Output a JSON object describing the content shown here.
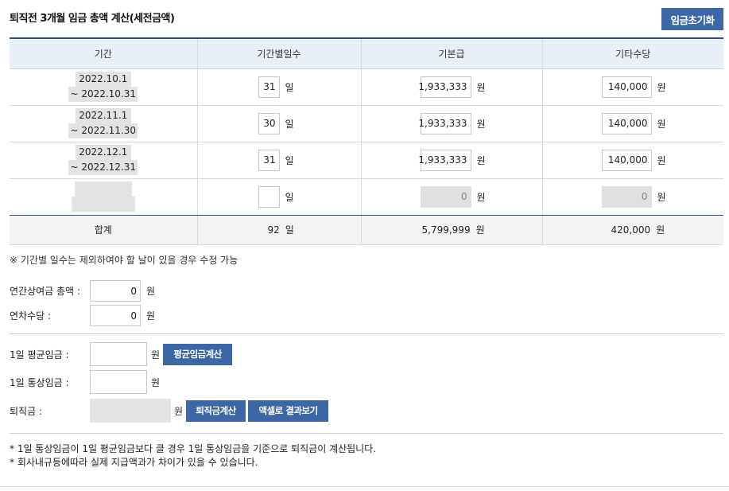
{
  "title": "퇴직전 3개월 임금 총액 계산(세전금액)",
  "reset_button": "임금초기화",
  "table": {
    "headers": [
      "기간",
      "기간별일수",
      "기본급",
      "기타수당"
    ],
    "day_unit": "일",
    "won_unit": "원",
    "rows": [
      {
        "period_start": "2022.10.1",
        "period_end": "~ 2022.10.31",
        "days": "31",
        "base": "1,933,333",
        "other": "140,000"
      },
      {
        "period_start": "2022.11.1",
        "period_end": "~ 2022.11.30",
        "days": "30",
        "base": "1,933,333",
        "other": "140,000"
      },
      {
        "period_start": "2022.12.1",
        "period_end": "~ 2022.12.31",
        "days": "31",
        "base": "1,933,333",
        "other": "140,000"
      },
      {
        "period_start": "",
        "period_end": "",
        "days": "",
        "base": "0",
        "other": "0"
      }
    ],
    "total": {
      "label": "합계",
      "days": "92",
      "base": "5,799,999",
      "other": "420,000"
    }
  },
  "note": "※ 기간별 일수는 제외하여야 할 날이 있을 경우 수정 가능",
  "bonus": {
    "label": "연간상여금 총액 :",
    "value": "0",
    "unit": "원"
  },
  "annual_leave": {
    "label": "연차수당 :",
    "value": "0",
    "unit": "원"
  },
  "avg_wage": {
    "label": "1일 평균임금 :",
    "value": "",
    "unit": "원",
    "button": "평균임금계산"
  },
  "ordinary_wage": {
    "label": "1일 통상임금 :",
    "value": "",
    "unit": "원"
  },
  "severance": {
    "label": "퇴직금 :",
    "value": "",
    "unit": "원",
    "calc_button": "퇴직금계산",
    "excel_button": "액셀로 결과보기"
  },
  "footnotes": [
    "* 1일 통상임금이 1일 평균임금보다 클 경우 1일 통상임금을 기준으로 퇴직금이 계산됩니다.",
    "* 회사내규등에따라 실제 지급액과가 차이가 있을 수 있습니다."
  ]
}
